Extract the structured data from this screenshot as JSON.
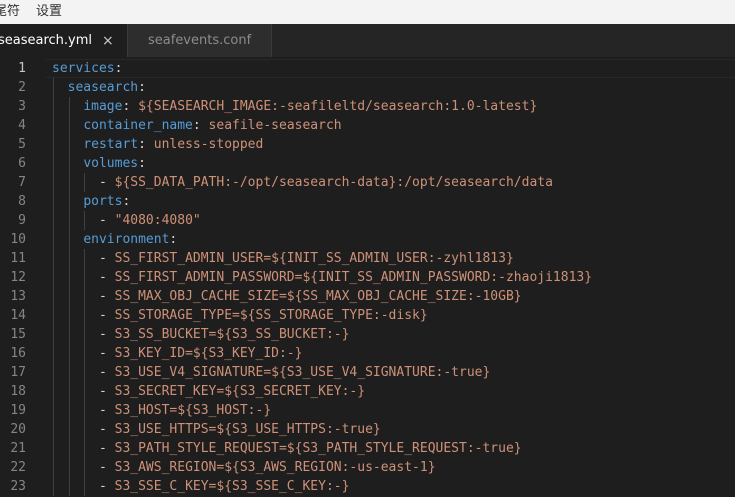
{
  "menu": {
    "items": [
      "尾符",
      "设置"
    ]
  },
  "tabs": [
    {
      "label": "seasearch.yml",
      "active": true,
      "close": "×"
    },
    {
      "label": "seafevents.conf",
      "active": false
    }
  ],
  "editor": {
    "language": "yaml",
    "current_line": 1,
    "lines": [
      {
        "n": "1",
        "indent": "",
        "dash": "",
        "key": "services",
        "colon": ":",
        "value": ""
      },
      {
        "n": "2",
        "indent": "  ",
        "dash": "",
        "key": "seasearch",
        "colon": ":",
        "value": ""
      },
      {
        "n": "3",
        "indent": "    ",
        "dash": "",
        "key": "image",
        "colon": ": ",
        "value": "${SEASEARCH_IMAGE:-seafileltd/seasearch:1.0-latest}"
      },
      {
        "n": "4",
        "indent": "    ",
        "dash": "",
        "key": "container_name",
        "colon": ": ",
        "value": "seafile-seasearch"
      },
      {
        "n": "5",
        "indent": "    ",
        "dash": "",
        "key": "restart",
        "colon": ": ",
        "value": "unless-stopped"
      },
      {
        "n": "6",
        "indent": "    ",
        "dash": "",
        "key": "volumes",
        "colon": ":",
        "value": ""
      },
      {
        "n": "7",
        "indent": "      ",
        "dash": "- ",
        "key": "",
        "colon": "",
        "value": "${SS_DATA_PATH:-/opt/seasearch-data}:/opt/seasearch/data"
      },
      {
        "n": "8",
        "indent": "    ",
        "dash": "",
        "key": "ports",
        "colon": ":",
        "value": ""
      },
      {
        "n": "9",
        "indent": "      ",
        "dash": "- ",
        "key": "",
        "colon": "",
        "value": "\"4080:4080\""
      },
      {
        "n": "10",
        "indent": "    ",
        "dash": "",
        "key": "environment",
        "colon": ":",
        "value": ""
      },
      {
        "n": "11",
        "indent": "      ",
        "dash": "- ",
        "key": "",
        "colon": "",
        "value": "SS_FIRST_ADMIN_USER=${INIT_SS_ADMIN_USER:-zyhl1813}"
      },
      {
        "n": "12",
        "indent": "      ",
        "dash": "- ",
        "key": "",
        "colon": "",
        "value": "SS_FIRST_ADMIN_PASSWORD=${INIT_SS_ADMIN_PASSWORD:-zhaoji1813}"
      },
      {
        "n": "13",
        "indent": "      ",
        "dash": "- ",
        "key": "",
        "colon": "",
        "value": "SS_MAX_OBJ_CACHE_SIZE=${SS_MAX_OBJ_CACHE_SIZE:-10GB}"
      },
      {
        "n": "14",
        "indent": "      ",
        "dash": "- ",
        "key": "",
        "colon": "",
        "value": "SS_STORAGE_TYPE=${SS_STORAGE_TYPE:-disk}"
      },
      {
        "n": "15",
        "indent": "      ",
        "dash": "- ",
        "key": "",
        "colon": "",
        "value": "S3_SS_BUCKET=${S3_SS_BUCKET:-}"
      },
      {
        "n": "16",
        "indent": "      ",
        "dash": "- ",
        "key": "",
        "colon": "",
        "value": "S3_KEY_ID=${S3_KEY_ID:-}"
      },
      {
        "n": "17",
        "indent": "      ",
        "dash": "- ",
        "key": "",
        "colon": "",
        "value": "S3_USE_V4_SIGNATURE=${S3_USE_V4_SIGNATURE:-true}"
      },
      {
        "n": "18",
        "indent": "      ",
        "dash": "- ",
        "key": "",
        "colon": "",
        "value": "S3_SECRET_KEY=${S3_SECRET_KEY:-}"
      },
      {
        "n": "19",
        "indent": "      ",
        "dash": "- ",
        "key": "",
        "colon": "",
        "value": "S3_HOST=${S3_HOST:-}"
      },
      {
        "n": "20",
        "indent": "      ",
        "dash": "- ",
        "key": "",
        "colon": "",
        "value": "S3_USE_HTTPS=${S3_USE_HTTPS:-true}"
      },
      {
        "n": "21",
        "indent": "      ",
        "dash": "- ",
        "key": "",
        "colon": "",
        "value": "S3_PATH_STYLE_REQUEST=${S3_PATH_STYLE_REQUEST:-true}"
      },
      {
        "n": "22",
        "indent": "      ",
        "dash": "- ",
        "key": "",
        "colon": "",
        "value": "S3_AWS_REGION=${S3_AWS_REGION:-us-east-1}"
      },
      {
        "n": "23",
        "indent": "      ",
        "dash": "- ",
        "key": "",
        "colon": "",
        "value": "S3_SSE_C_KEY=${S3_SSE_C_KEY:-}"
      }
    ]
  },
  "colors": {
    "editor_bg": "#1e1e1e",
    "keyword": "#569cd6",
    "string": "#ce9178",
    "punctuation": "#d4d4d4",
    "line_number": "#858585"
  }
}
